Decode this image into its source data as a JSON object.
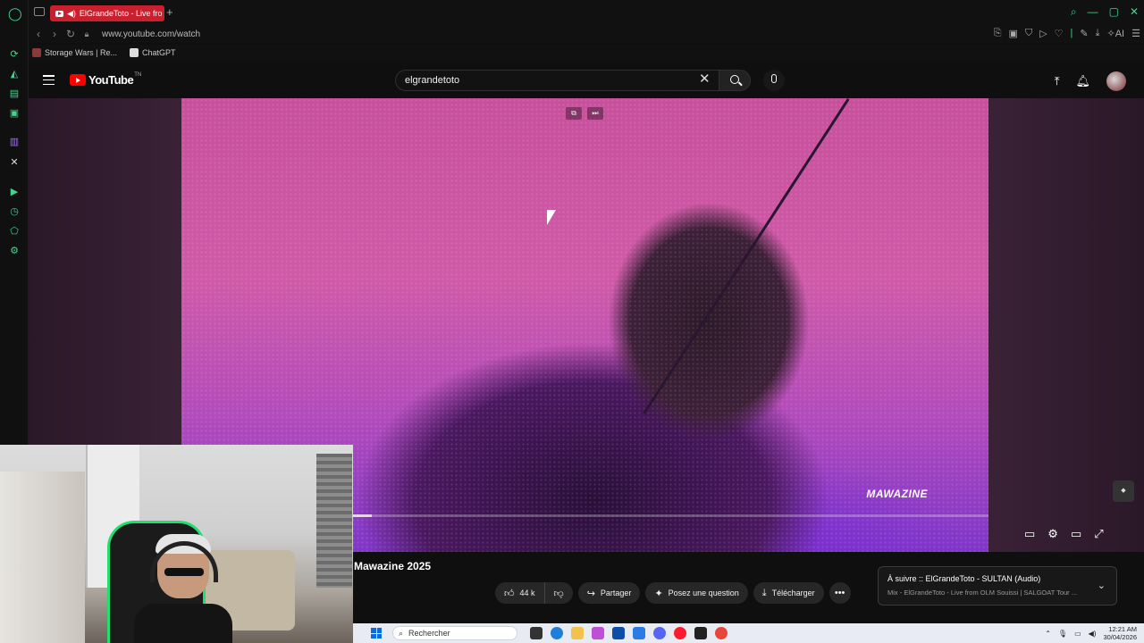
{
  "browser": {
    "tab_title": "ElGrandeToto - Live fro",
    "url": "www.youtube.com/watch",
    "bookmarks": [
      {
        "label": "Storage Wars | Re..."
      },
      {
        "label": "ChatGPT"
      }
    ]
  },
  "youtube": {
    "logo_text": "YouTube",
    "logo_suffix": "TN",
    "search_value": "elgrandetoto"
  },
  "video": {
    "watermark": "MAWAZINE",
    "title": "Mawazine 2025",
    "progress_fraction": 0.03
  },
  "actions": {
    "likes": "44 k",
    "share": "Partager",
    "ask": "Posez une question",
    "download": "Télécharger"
  },
  "up_next": {
    "label": "À suivre :: ElGrandeToto - SULTAN (Audio)",
    "subtitle": "Mix - ElGrandeToto - Live from OLM Souissi | SALGOAT Tour ..."
  },
  "taskbar": {
    "search_placeholder": "Rechercher",
    "time": "12:21 AM",
    "date": "30/04/2026"
  },
  "colors": {
    "youtube_red": "#ff0000",
    "opera_green": "#3fd68c",
    "taskbar_bg": "#e8ecf2"
  }
}
